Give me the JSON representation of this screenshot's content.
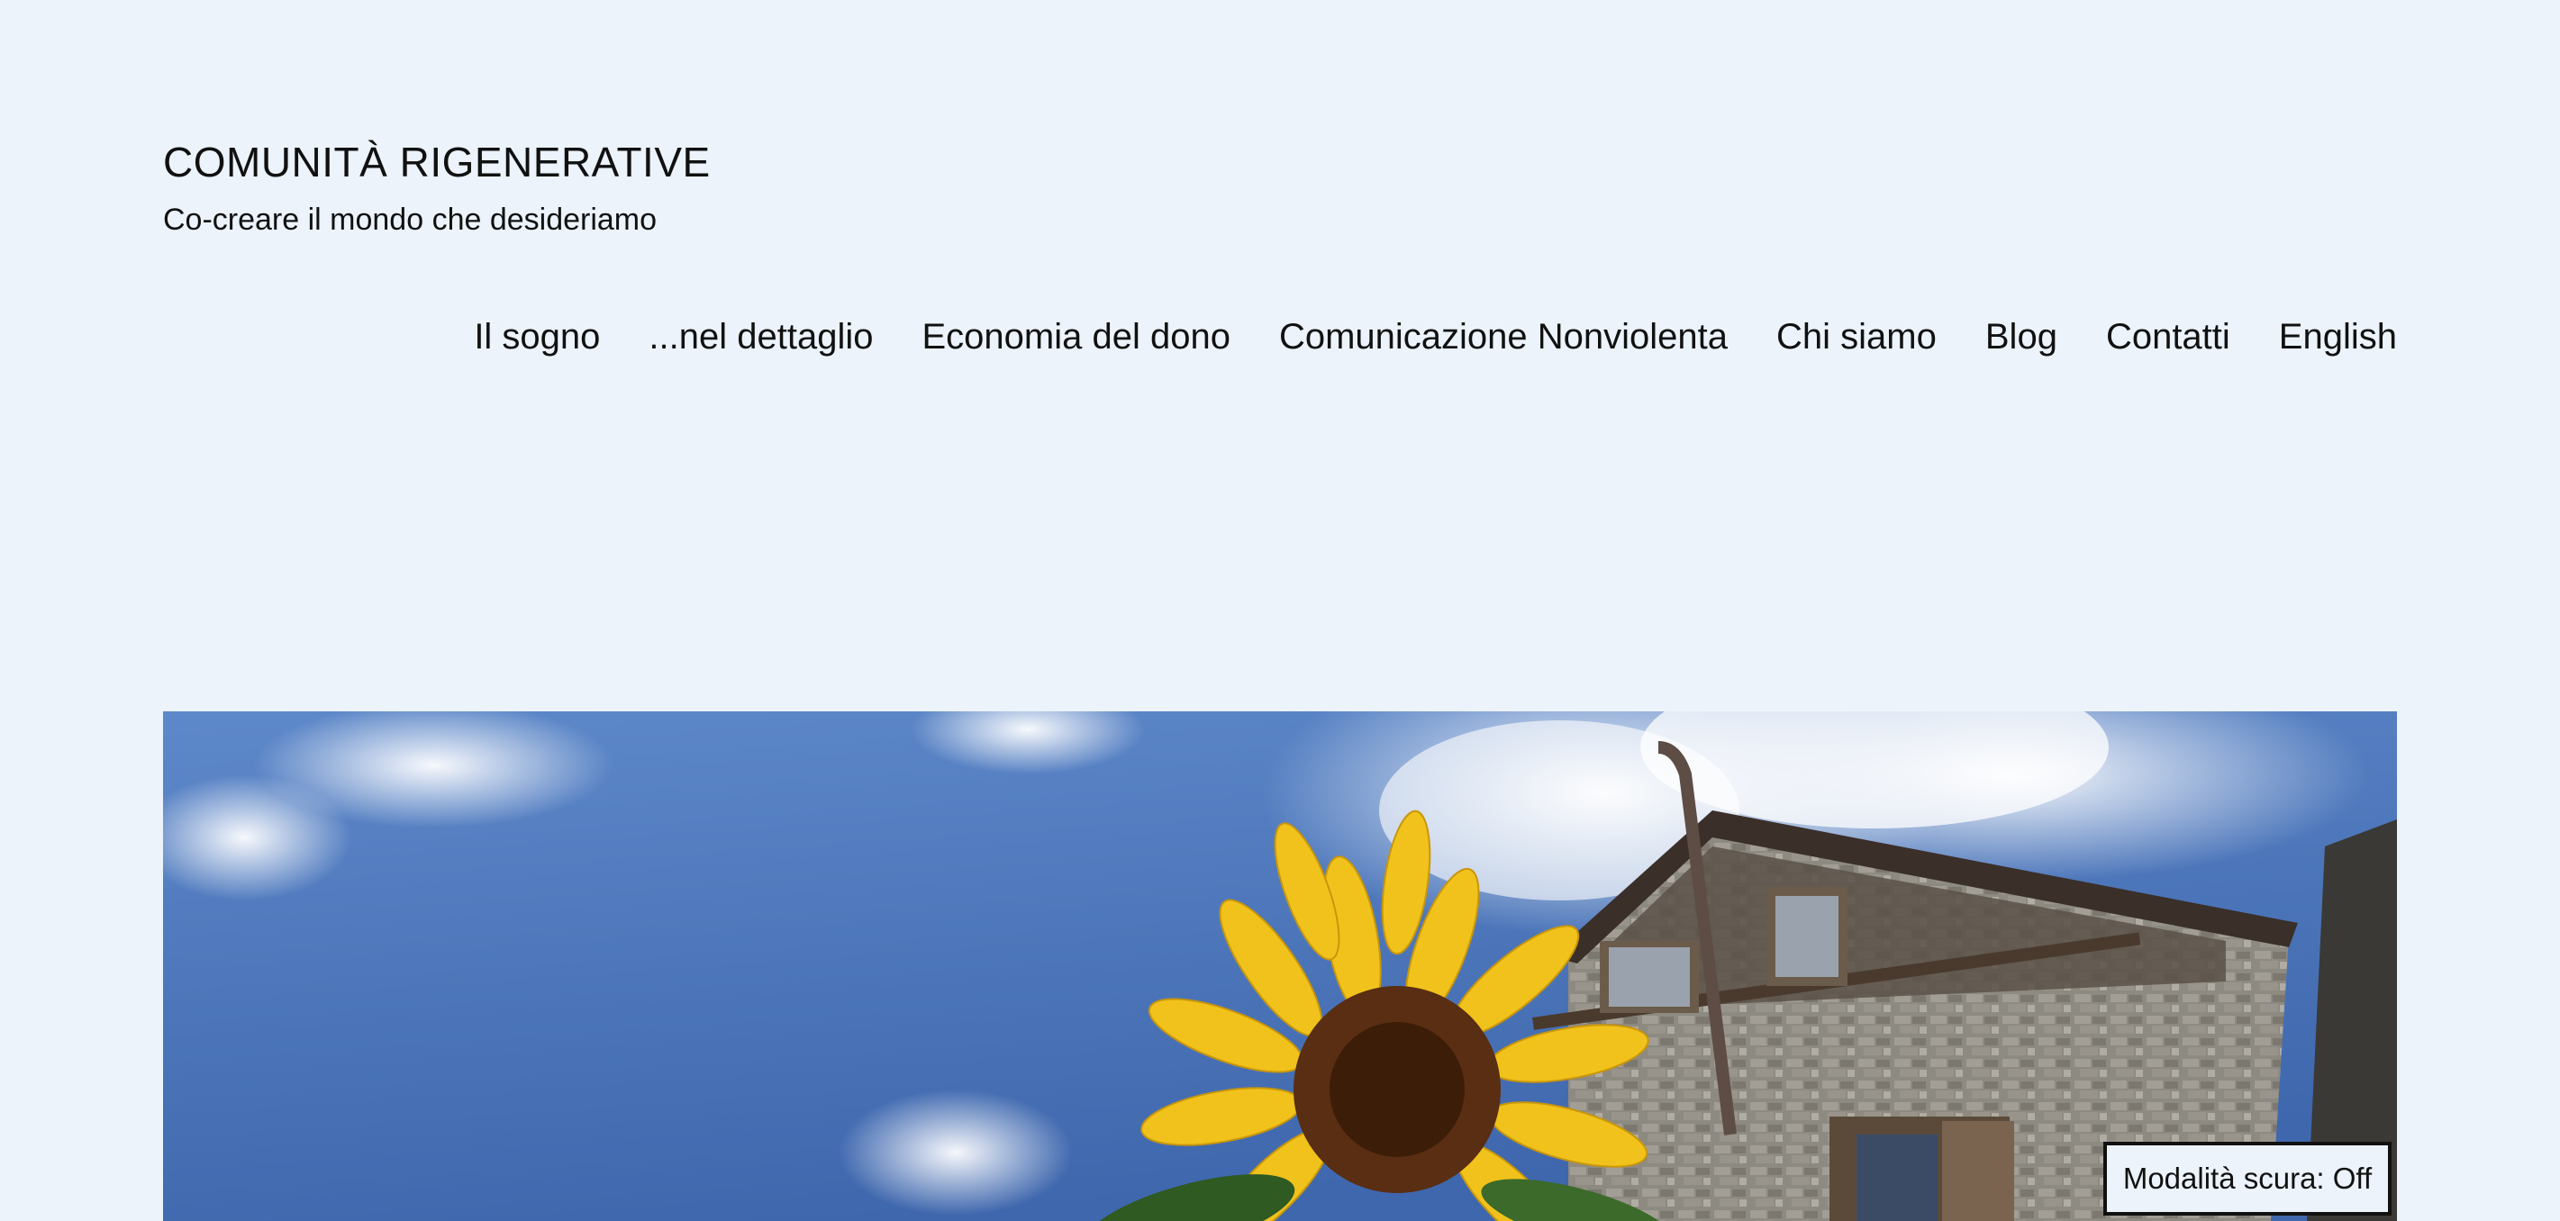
{
  "site": {
    "title": "COMUNITÀ RIGENERATIVE",
    "tagline": "Co-creare il mondo che desideriamo"
  },
  "nav": {
    "items": [
      {
        "label": "Il sogno"
      },
      {
        "label": "...nel dettaglio"
      },
      {
        "label": "Economia del dono"
      },
      {
        "label": "Comunicazione Nonviolenta"
      },
      {
        "label": "Chi siamo"
      },
      {
        "label": "Blog"
      },
      {
        "label": "Contatti"
      },
      {
        "label": "English"
      }
    ]
  },
  "hero": {
    "subject": "sunflower in front of a stone house under a blue sky"
  },
  "dark_mode": {
    "label": "Modalità scura: Off"
  },
  "colors": {
    "background": "#ecf3fa",
    "text": "#111111",
    "sky": "#4f79bf",
    "sunflower": "#f1c21b"
  }
}
